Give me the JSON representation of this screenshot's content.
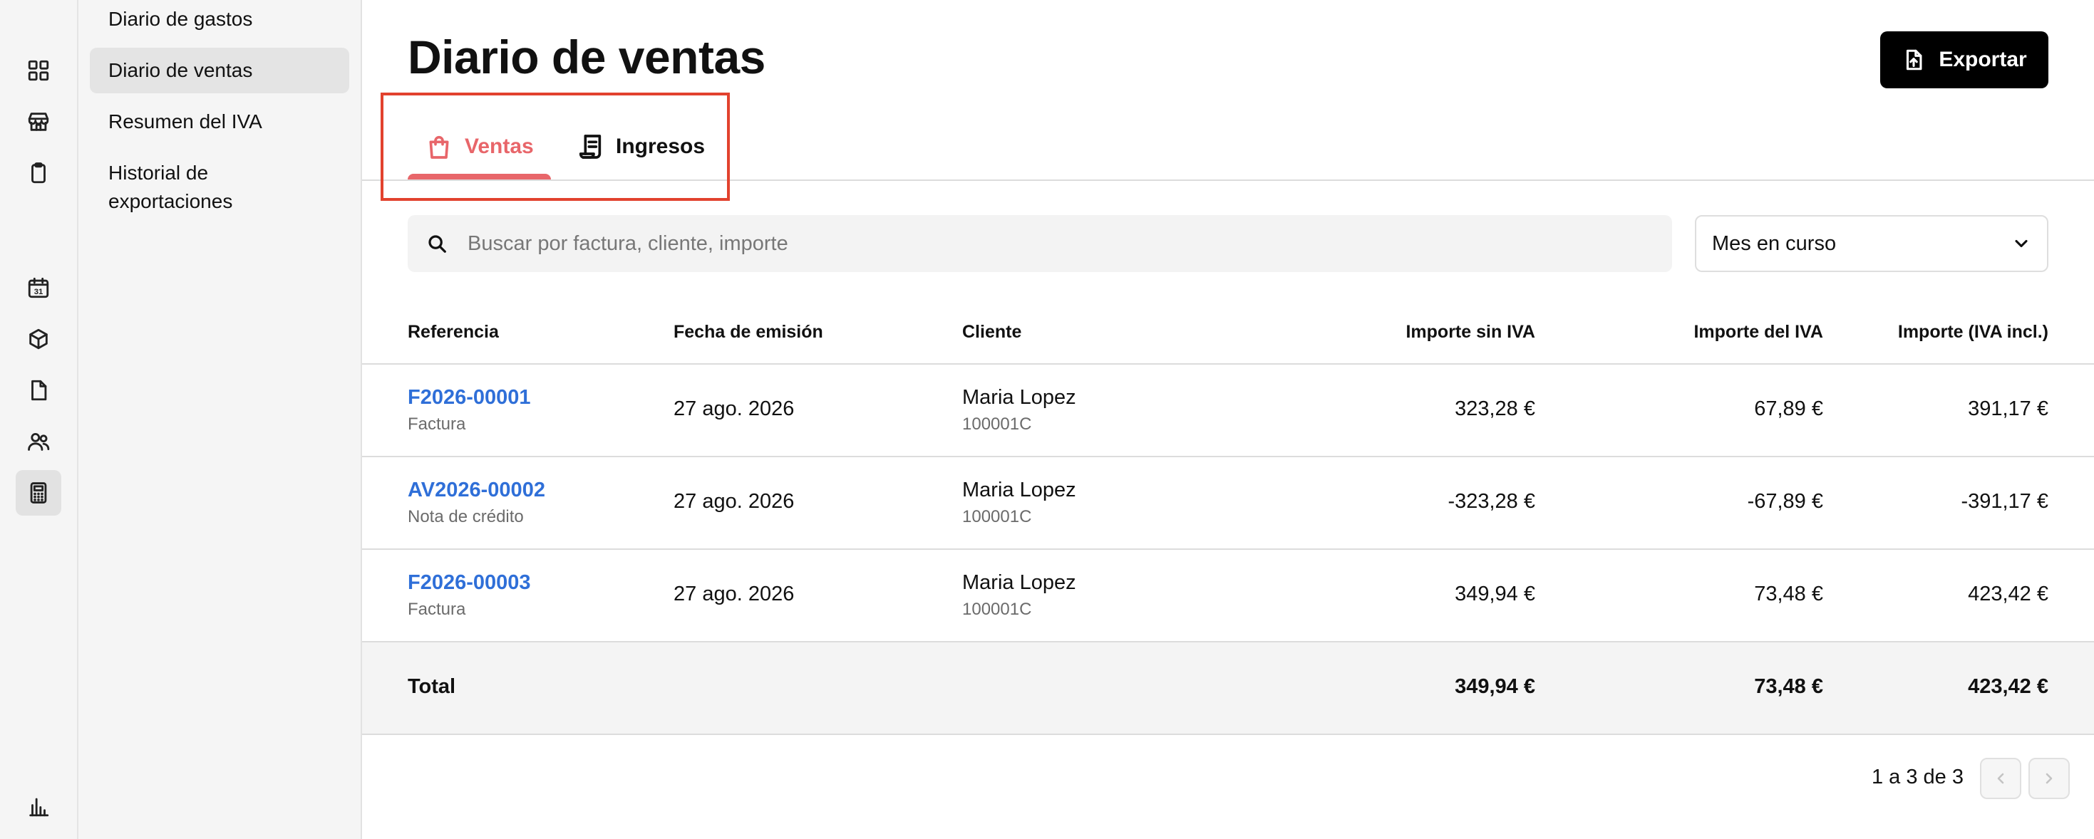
{
  "rail": {
    "icons": [
      "dashboard-icon",
      "store-icon",
      "clipboard-icon",
      "calendar-icon",
      "box-icon",
      "document-icon",
      "users-icon",
      "calculator-icon",
      "chart-icon"
    ],
    "calendar_day": "31"
  },
  "subnav": {
    "items": [
      {
        "label": "Diario de gastos"
      },
      {
        "label": "Diario de ventas",
        "active": true
      },
      {
        "label": "Resumen del IVA"
      },
      {
        "label": "Historial de exportaciones"
      }
    ]
  },
  "header": {
    "title": "Diario de ventas",
    "export_label": "Exportar"
  },
  "tabs": [
    {
      "label": "Ventas",
      "icon": "shopping-bag-icon",
      "active": true
    },
    {
      "label": "Ingresos",
      "icon": "receipt-icon",
      "active": false
    }
  ],
  "filters": {
    "search_placeholder": "Buscar por factura, cliente, importe",
    "period_value": "Mes en curso"
  },
  "table": {
    "columns": [
      "Referencia",
      "Fecha de emisión",
      "Cliente",
      "Importe sin IVA",
      "Importe del IVA",
      "Importe (IVA incl.)"
    ],
    "rows": [
      {
        "ref": "F2026-00001",
        "type": "Factura",
        "date": "27 ago. 2026",
        "client": "Maria Lopez",
        "client_code": "100001C",
        "net": "323,28 €",
        "vat": "67,89 €",
        "gross": "391,17 €"
      },
      {
        "ref": "AV2026-00002",
        "type": "Nota de crédito",
        "date": "27 ago. 2026",
        "client": "Maria Lopez",
        "client_code": "100001C",
        "net": "-323,28 €",
        "vat": "-67,89 €",
        "gross": "-391,17 €"
      },
      {
        "ref": "F2026-00003",
        "type": "Factura",
        "date": "27 ago. 2026",
        "client": "Maria Lopez",
        "client_code": "100001C",
        "net": "349,94 €",
        "vat": "73,48 €",
        "gross": "423,42 €"
      }
    ],
    "total": {
      "label": "Total",
      "net": "349,94 €",
      "vat": "73,48 €",
      "gross": "423,42 €"
    }
  },
  "pagination": {
    "text": "1 a 3 de 3"
  },
  "colors": {
    "accent": "#e8666a",
    "link": "#2f6fd8",
    "highlight": "#e2422e"
  }
}
